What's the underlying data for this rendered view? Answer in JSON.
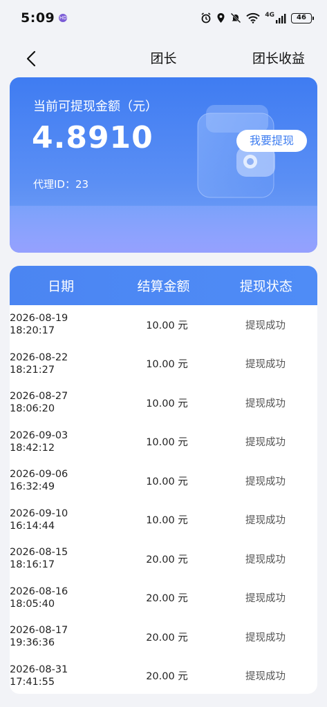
{
  "status_bar": {
    "time": "5:09",
    "badge": "HD",
    "network": "4G",
    "battery": "46"
  },
  "nav": {
    "title": "团长",
    "action": "团长收益"
  },
  "balance": {
    "label": "当前可提现金额（元）",
    "amount": "4.8910",
    "agent_label": "代理ID：",
    "agent_id": "23",
    "withdraw_label": "我要提现"
  },
  "table": {
    "headers": [
      "日期",
      "结算金额",
      "提现状态"
    ],
    "rows": [
      {
        "date": "2026-08-19",
        "time": "18:20:17",
        "amount": "10.00 元",
        "status": "提现成功"
      },
      {
        "date": "2026-08-22",
        "time": "18:21:27",
        "amount": "10.00 元",
        "status": "提现成功"
      },
      {
        "date": "2026-08-27",
        "time": "18:06:20",
        "amount": "10.00 元",
        "status": "提现成功"
      },
      {
        "date": "2026-09-03",
        "time": "18:42:12",
        "amount": "10.00 元",
        "status": "提现成功"
      },
      {
        "date": "2026-09-06",
        "time": "16:32:49",
        "amount": "10.00 元",
        "status": "提现成功"
      },
      {
        "date": "2026-09-10",
        "time": "16:14:44",
        "amount": "10.00 元",
        "status": "提现成功"
      },
      {
        "date": "2026-08-15",
        "time": "18:16:17",
        "amount": "20.00 元",
        "status": "提现成功"
      },
      {
        "date": "2026-08-16",
        "time": "18:05:40",
        "amount": "20.00 元",
        "status": "提现成功"
      },
      {
        "date": "2026-08-17",
        "time": "19:36:36",
        "amount": "20.00 元",
        "status": "提现成功"
      },
      {
        "date": "2026-08-31",
        "time": "17:41:55",
        "amount": "20.00 元",
        "status": "提现成功"
      }
    ]
  },
  "colors": {
    "accent": "#3f7cf2",
    "table_header": "#4b85f2",
    "page_bg": "#f2f3f7"
  },
  "icons": [
    "back-arrow-icon",
    "alarm-icon",
    "location-icon",
    "mute-icon",
    "wifi-icon",
    "signal-icon",
    "battery-icon",
    "wallet-icon"
  ]
}
